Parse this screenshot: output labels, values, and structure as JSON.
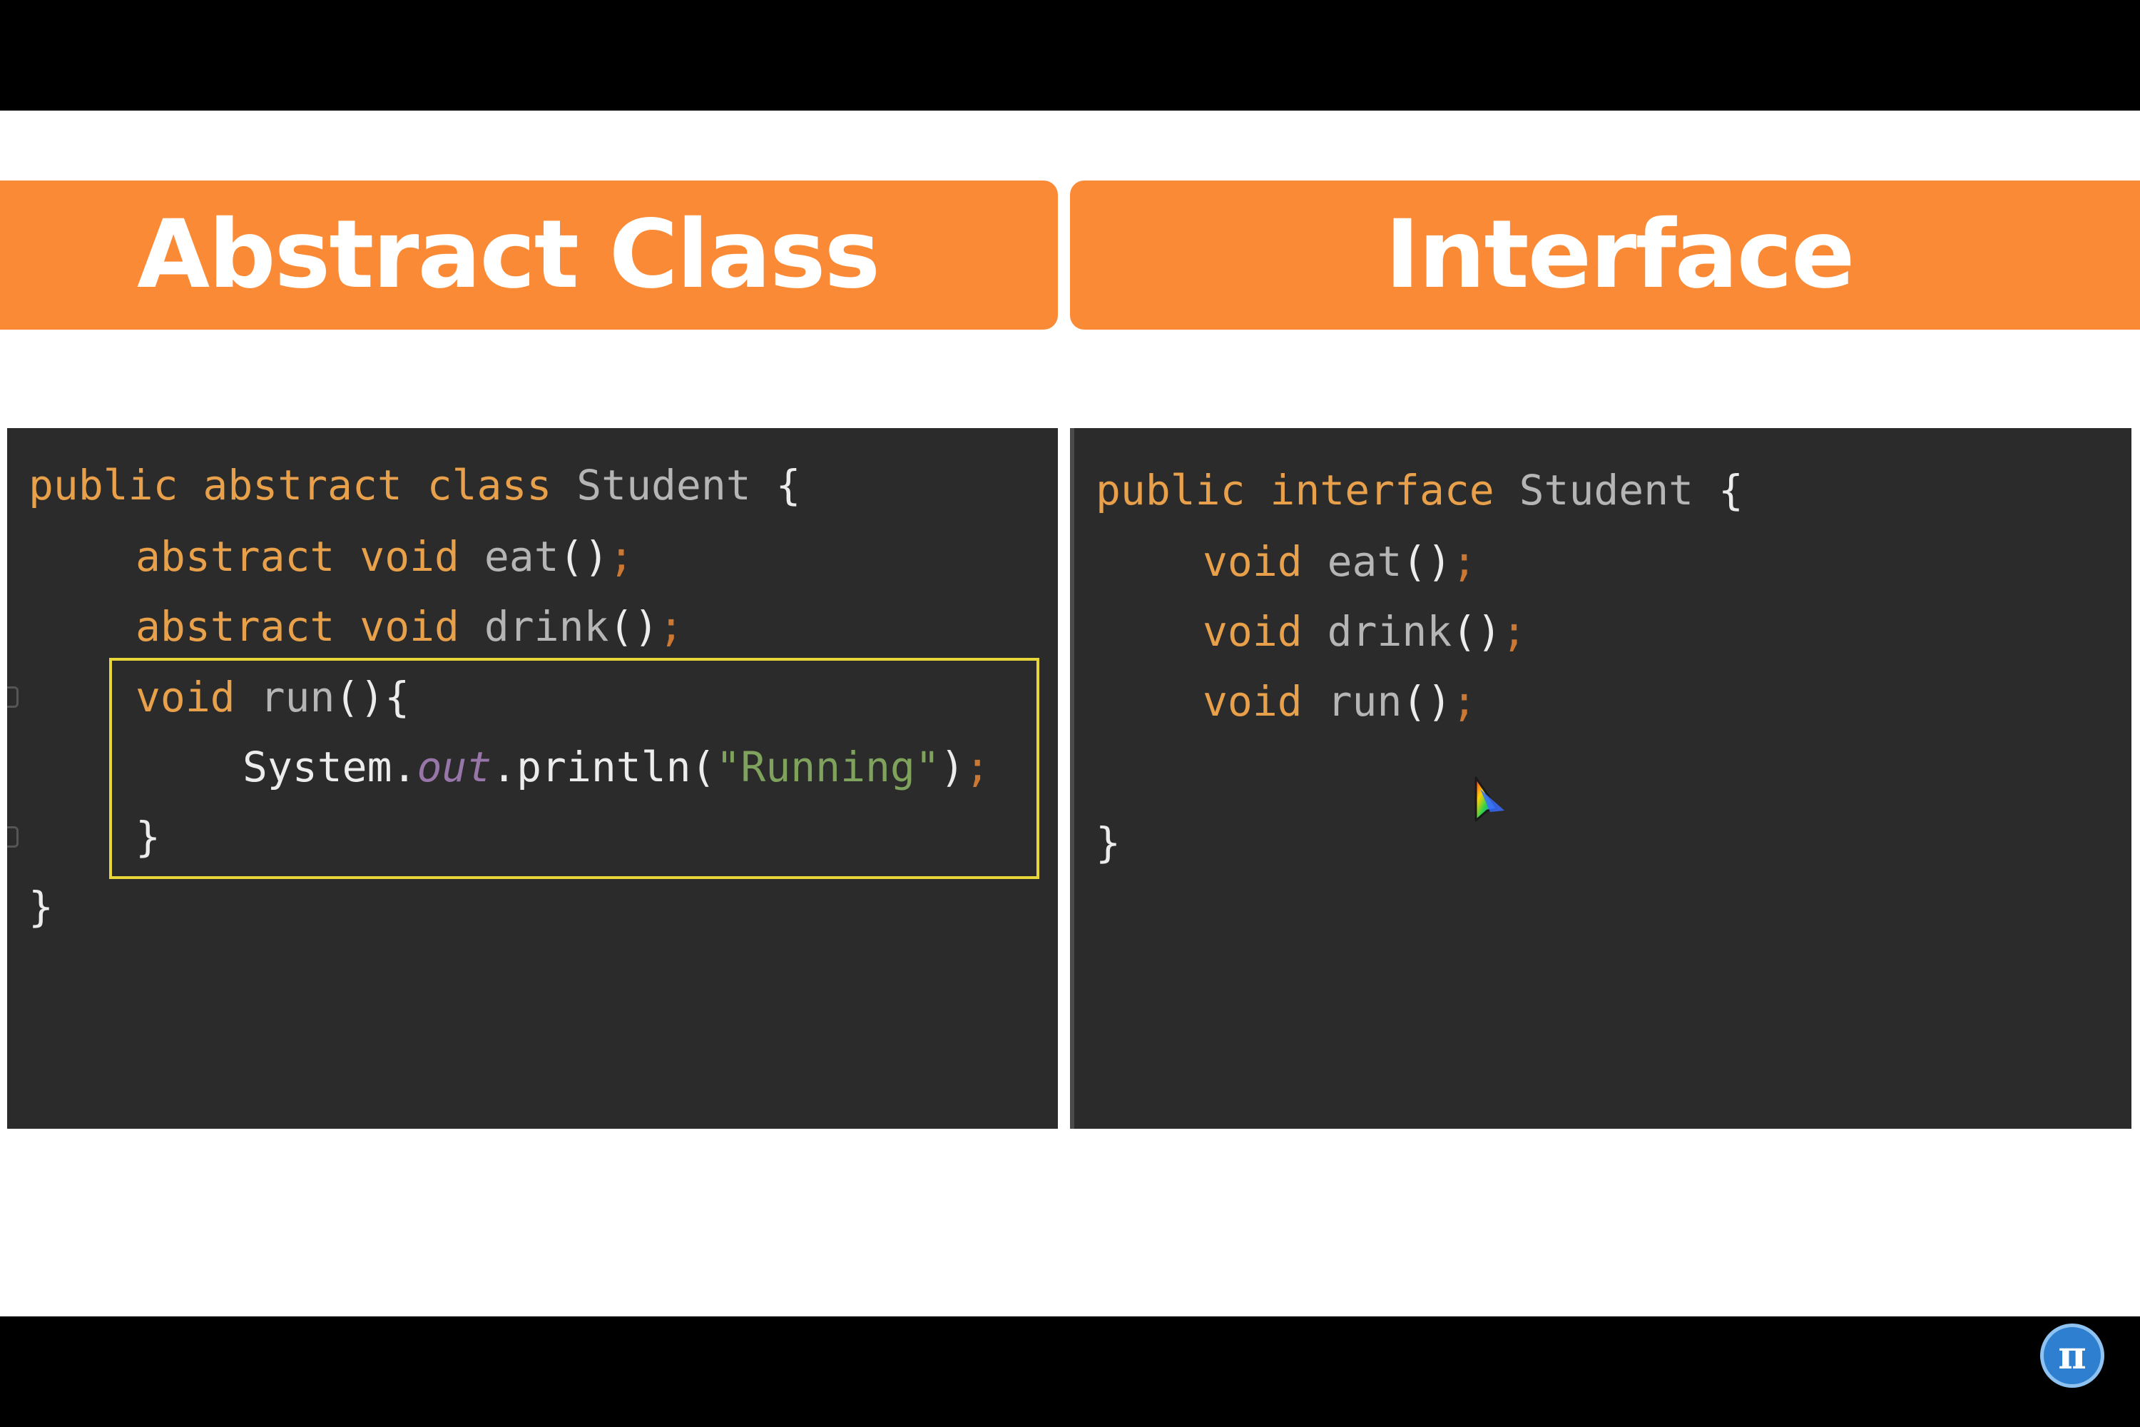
{
  "headers": {
    "left": "Abstract Class",
    "right": "Interface"
  },
  "code_left": {
    "line1": {
      "kw": "public abstract class",
      "name": "Student",
      "brace": "{"
    },
    "line2": {
      "kw": "abstract void",
      "name": "eat",
      "parens": "()",
      "semi": ";"
    },
    "line3": {
      "kw": "abstract void",
      "name": "drink",
      "parens": "()",
      "semi": ";"
    },
    "line4": {
      "kw": "void",
      "name": "run",
      "parens": "(){"
    },
    "line5": {
      "obj": "System.",
      "field": "out",
      "method": ".println(",
      "str": "\"Running\"",
      "close": ")",
      "semi": ";"
    },
    "line6": {
      "brace": "}"
    },
    "line7": {
      "brace": "}"
    }
  },
  "code_right": {
    "line1": {
      "kw": "public interface",
      "name": "Student",
      "brace": "{"
    },
    "line2": {
      "kw": "void",
      "name": "eat",
      "parens": "()",
      "semi": ";"
    },
    "line3": {
      "kw": "void",
      "name": "drink",
      "parens": "()",
      "semi": ";"
    },
    "line4": {
      "kw": "void",
      "name": "run",
      "parens": "()",
      "semi": ";"
    },
    "line5": {
      "brace": "}"
    }
  },
  "logo": {
    "symbol": "π"
  },
  "colors": {
    "accent_orange": "#fa8a35",
    "code_background": "#2b2b2b",
    "keyword": "#e8a04a",
    "string": "#7fa35d",
    "highlight_border": "#e6d63a"
  }
}
